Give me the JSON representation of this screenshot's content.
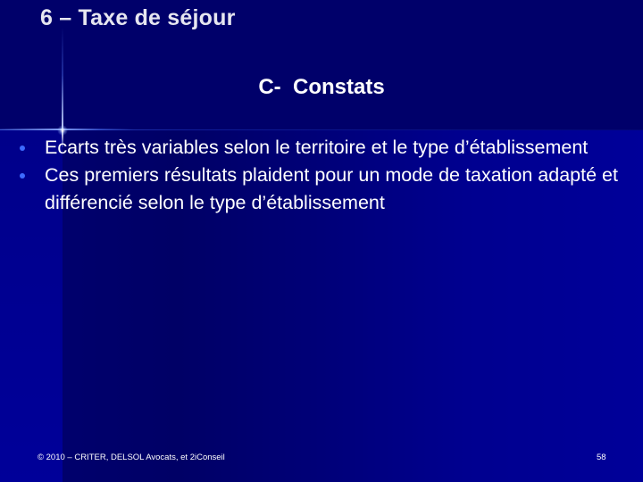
{
  "slide": {
    "title": "6 – Taxe de séjour",
    "subtitle": "C-  Constats",
    "bullets": [
      {
        "text": "Ecarts très variables selon le territoire et le type d’établissement"
      },
      {
        "text": "Ces premiers résultats plaident pour un mode de taxation adapté et différencié selon le type d’établissement"
      }
    ],
    "footer": {
      "copyright": "© 2010 – CRITER, DELSOL Avocats, et 2iConseil",
      "page_number": "58"
    }
  },
  "colors": {
    "background_top": "#00006a",
    "background_body": "#000099",
    "title_text": "#e6e6f0",
    "body_text": "#ffffff",
    "bullet": "#3d6bff"
  }
}
